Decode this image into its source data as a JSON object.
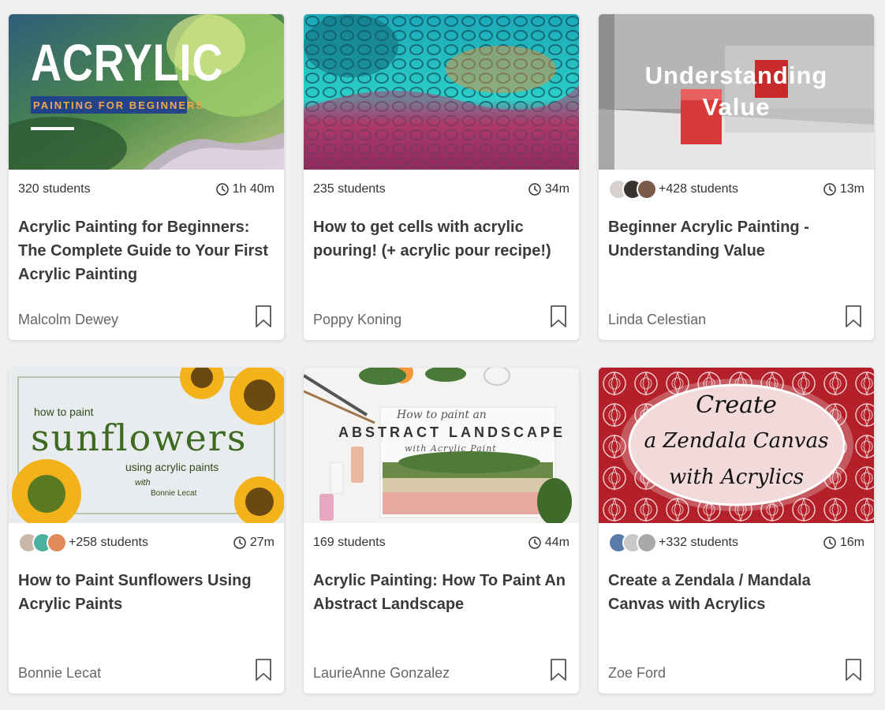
{
  "cards": [
    {
      "thumb_text": {
        "line1": "ACRYLIC",
        "line2": "PAINTING FOR BEGINNERS"
      },
      "students": "320 students",
      "duration": "1h 40m",
      "title": "Acrylic Painting for Beginners: The Complete Guide to Your First Acrylic Painting",
      "teacher": "Malcolm Dewey"
    },
    {
      "thumb_text": {},
      "students": "235 students",
      "duration": "34m",
      "title": "How to get cells with acrylic pouring! (+ acrylic pour recipe!)",
      "teacher": "Poppy Koning"
    },
    {
      "thumb_text": {
        "line1": "Understanding",
        "line2": "Value"
      },
      "students": "+428 students",
      "duration": "13m",
      "title": "Beginner Acrylic Painting - Understanding Value",
      "teacher": "Linda Celestian"
    },
    {
      "thumb_text": {
        "line1": "how to paint",
        "line2": "sunflowers",
        "line3": "using acrylic paints",
        "line4": "with",
        "line5": "Bonnie Lecat"
      },
      "students": "+258 students",
      "duration": "27m",
      "title": "How to Paint Sunflowers Using Acrylic Paints",
      "teacher": "Bonnie Lecat"
    },
    {
      "thumb_text": {
        "line1": "How to paint an",
        "line2": "ABSTRACT LANDSCAPE",
        "line3": "with Acrylic Paint"
      },
      "students": "169 students",
      "duration": "44m",
      "title": "Acrylic Painting: How To Paint An Abstract Landscape",
      "teacher": "LaurieAnne Gonzalez"
    },
    {
      "thumb_text": {
        "line1": "Create",
        "line2": "a Zendala Canvas",
        "line3": "with Acrylics"
      },
      "students": "+332 students",
      "duration": "16m",
      "title": "Create a Zendala / Mandala Canvas with Acrylics",
      "teacher": "Zoe Ford"
    }
  ],
  "icons": {
    "clock": "clock-icon",
    "bookmark": "bookmark-icon"
  },
  "colors": {
    "background": "#f0f0f0",
    "card": "#ffffff",
    "text": "#333333",
    "teacher": "#666666"
  }
}
